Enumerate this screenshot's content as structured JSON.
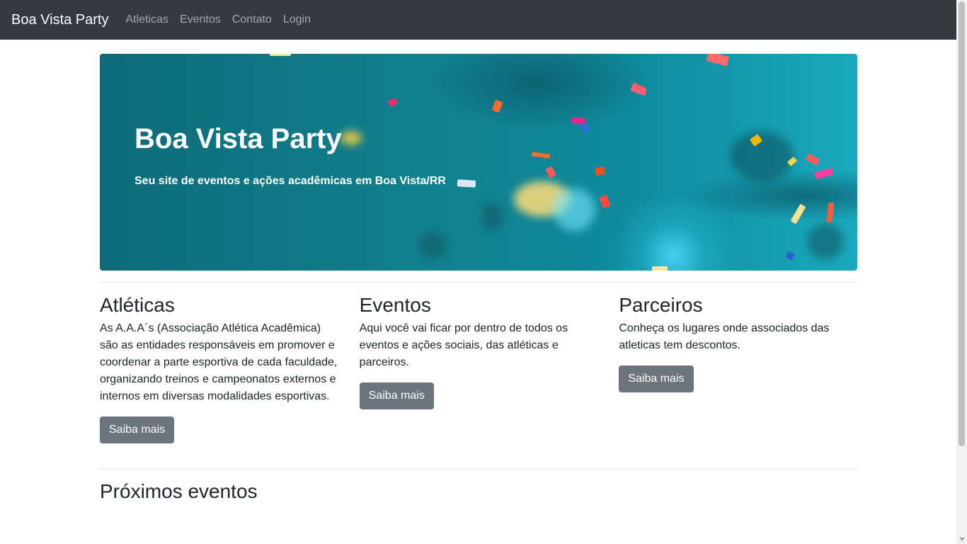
{
  "navbar": {
    "brand": "Boa Vista Party",
    "links": [
      {
        "label": "Atleticas"
      },
      {
        "label": "Eventos"
      },
      {
        "label": "Contato"
      },
      {
        "label": "Login"
      }
    ]
  },
  "hero": {
    "title": "Boa Vista Party",
    "subtitle": "Seu site de eventos e ações acadêmicas em Boa Vista/RR"
  },
  "sections": [
    {
      "title": "Atléticas",
      "text": "As A.A.A´s (Associação Atlética Acadêmica) são as entidades responsáveis em promover e coordenar a parte esportiva de cada faculdade, organizando treinos e campeonatos externos e internos em diversas modalidades esportivas.",
      "button": "Saiba mais"
    },
    {
      "title": "Eventos",
      "text": "Aqui você vai ficar por dentro de todos os eventos e ações sociais, das atléticas e parceiros.",
      "button": "Saiba mais"
    },
    {
      "title": "Parceiros",
      "text": "Conheça os lugares onde associados das atleticas tem descontos.",
      "button": "Saiba mais"
    }
  ],
  "upcoming": {
    "title": "Próximos eventos"
  },
  "colors": {
    "navbar_bg": "#343a40",
    "button_bg": "#6c757d",
    "hero_bg": "#0e8b9c"
  }
}
